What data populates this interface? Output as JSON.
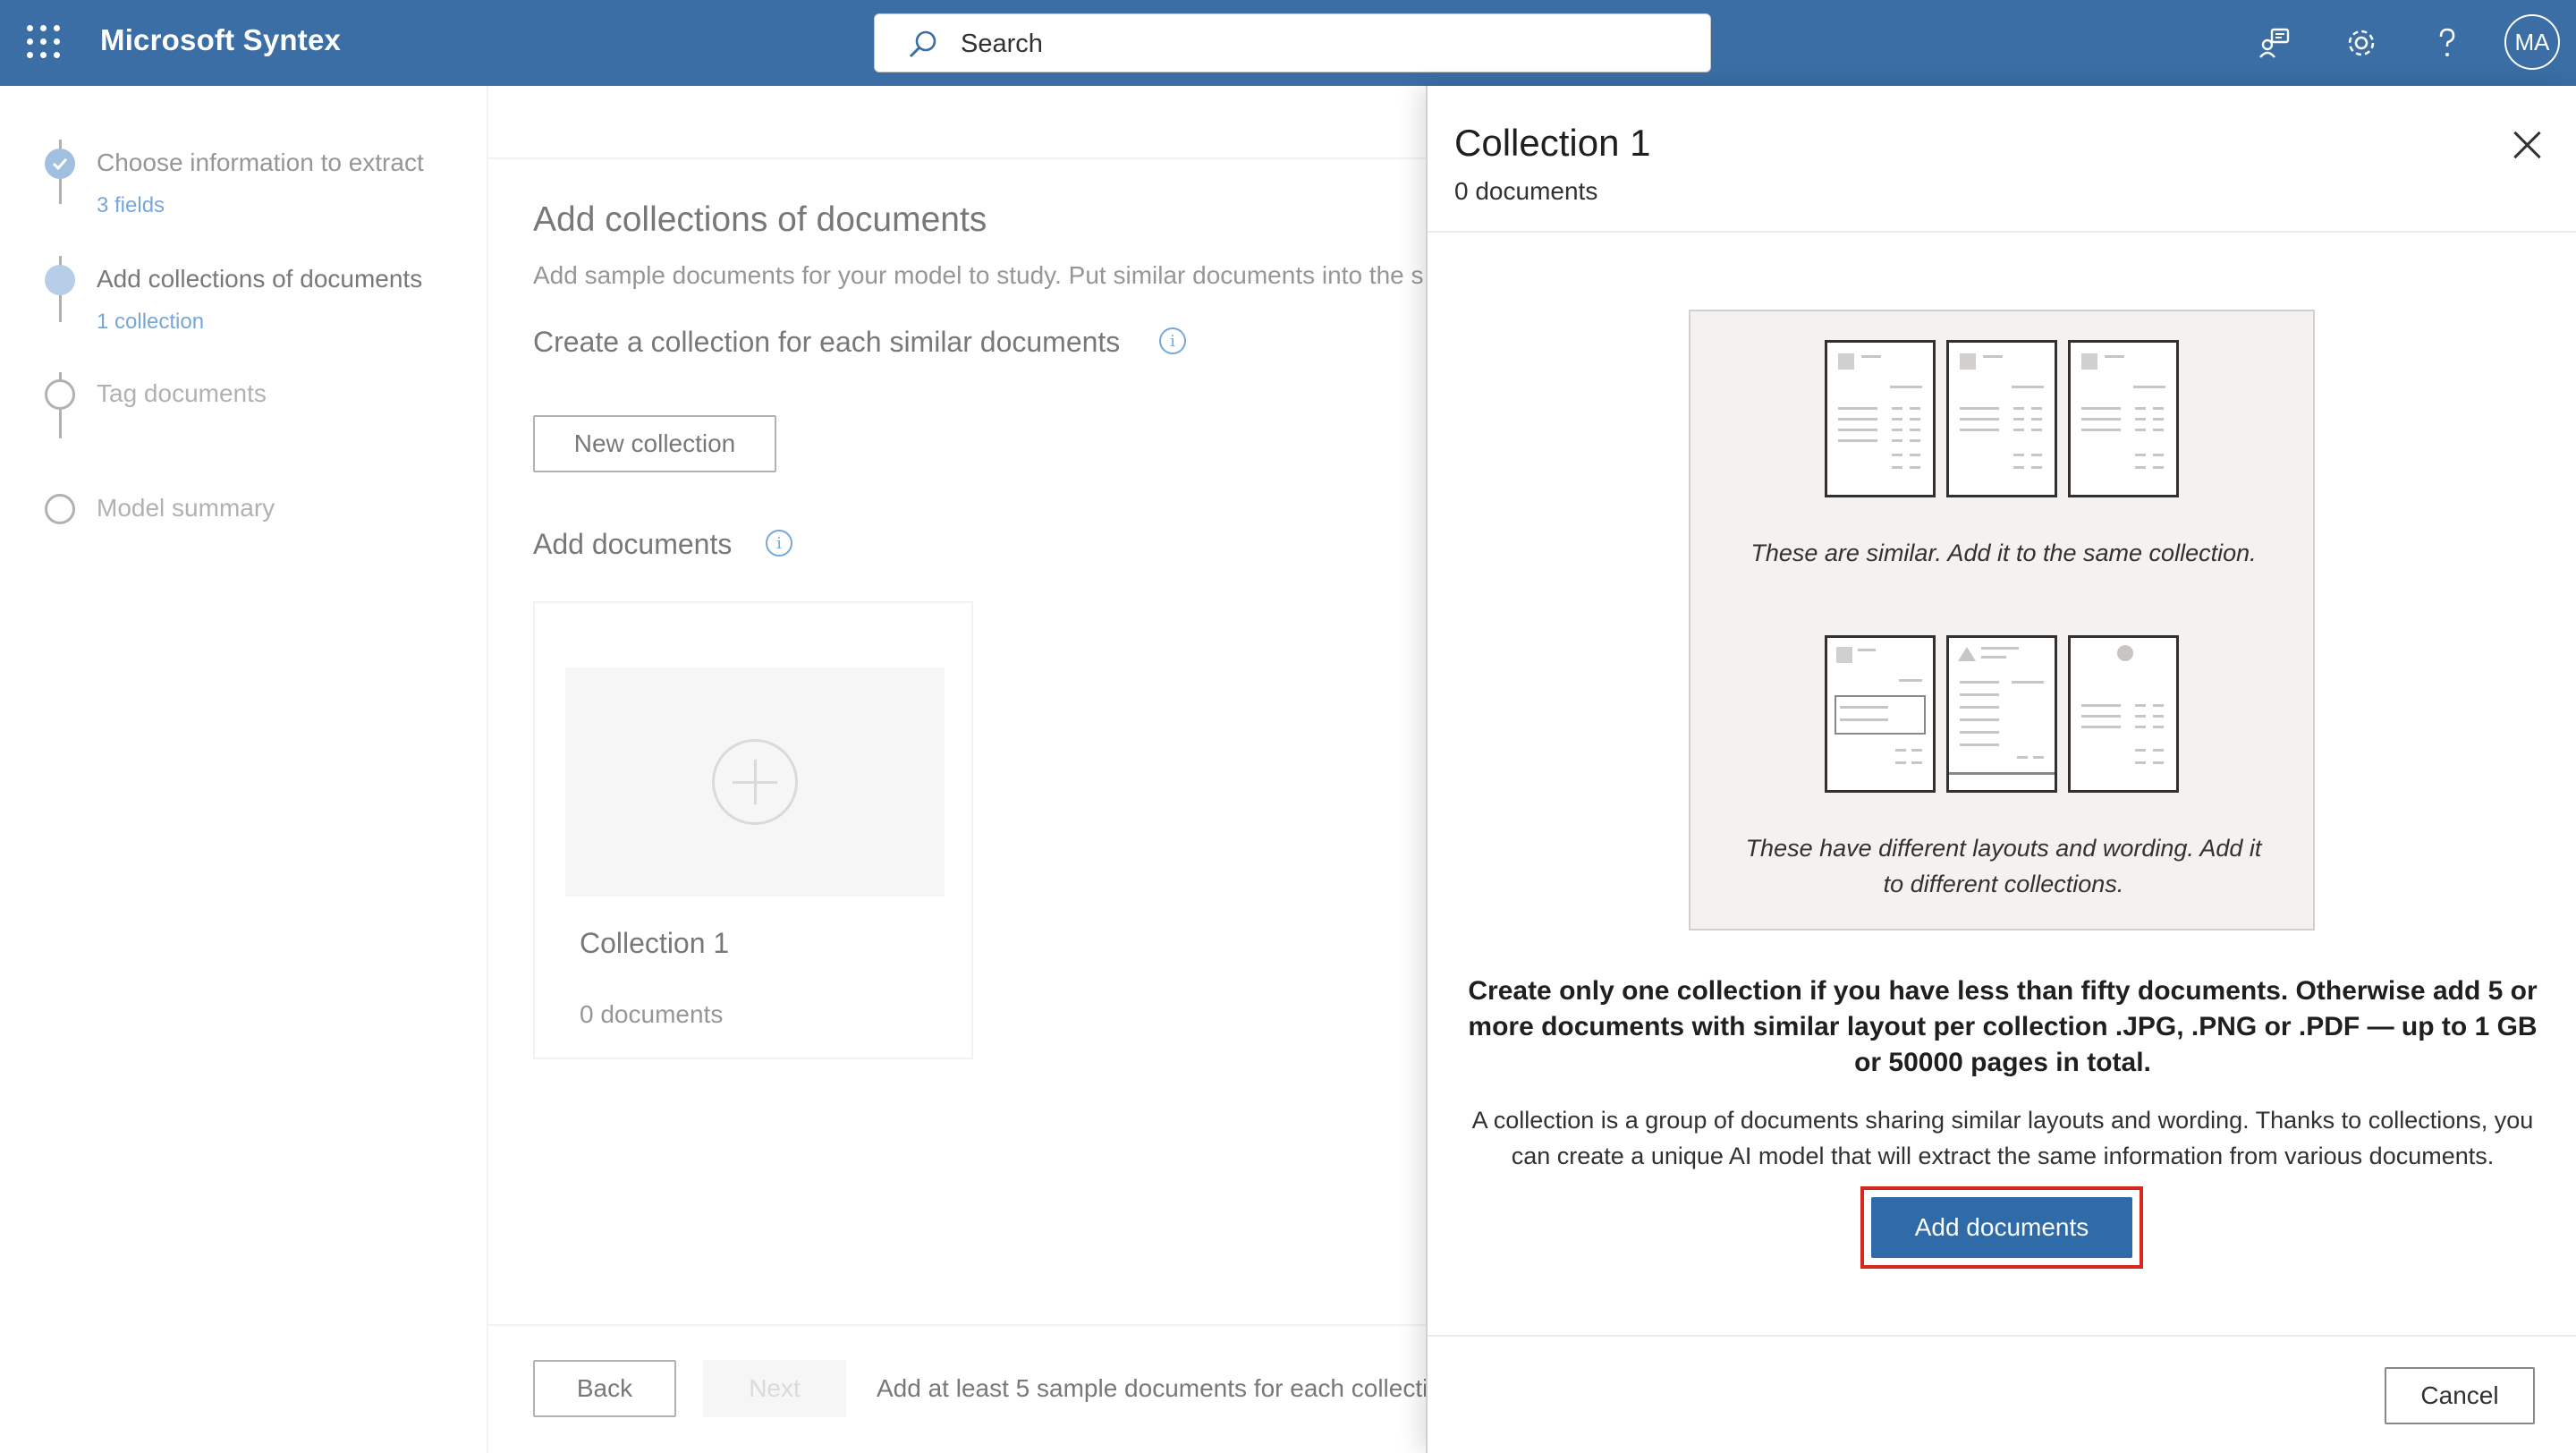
{
  "topbar": {
    "app_title": "Microsoft Syntex",
    "search_placeholder": "Search",
    "avatar_initials": "MA",
    "icons": [
      "app-launcher-icon",
      "feedback-icon",
      "settings-gear-icon",
      "help-icon"
    ],
    "color": "#3a6ea5"
  },
  "steps": [
    {
      "label": "Choose information to extract",
      "sub": "3 fields",
      "state": "completed"
    },
    {
      "label": "Add collections of documents",
      "sub": "1 collection",
      "state": "current"
    },
    {
      "label": "Tag documents",
      "sub": "",
      "state": "pending"
    },
    {
      "label": "Model summary",
      "sub": "",
      "state": "pending"
    }
  ],
  "main": {
    "title": "Add collections of documents",
    "description": "Add sample documents for your model to study. Put similar documents into the s",
    "create_heading": "Create a collection for each similar documents",
    "new_collection_label": "New collection",
    "add_documents_heading": "Add documents",
    "card": {
      "name": "Collection 1",
      "count": "0 documents"
    },
    "footer": {
      "back_label": "Back",
      "next_label": "Next",
      "message": "Add at least 5 sample documents for each collecti"
    }
  },
  "panel": {
    "title": "Collection 1",
    "count": "0 documents",
    "caption_similar": "These are similar. Add it to the same collection.",
    "caption_different": "These have different layouts and wording. Add it to different collections.",
    "bold_text": "Create only one collection if you have less than fifty documents. Otherwise add 5 or more documents with similar layout per collection .JPG, .PNG or .PDF — up to 1 GB or 50000 pages in total.",
    "body_text": "A collection is a group of documents sharing similar layouts and wording. Thanks to collections, you can create a unique AI model that will extract the same information from various documents.",
    "add_documents_label": "Add documents",
    "cancel_label": "Cancel",
    "accent_color": "#2e6ba8",
    "highlight_color": "#d7281f"
  }
}
